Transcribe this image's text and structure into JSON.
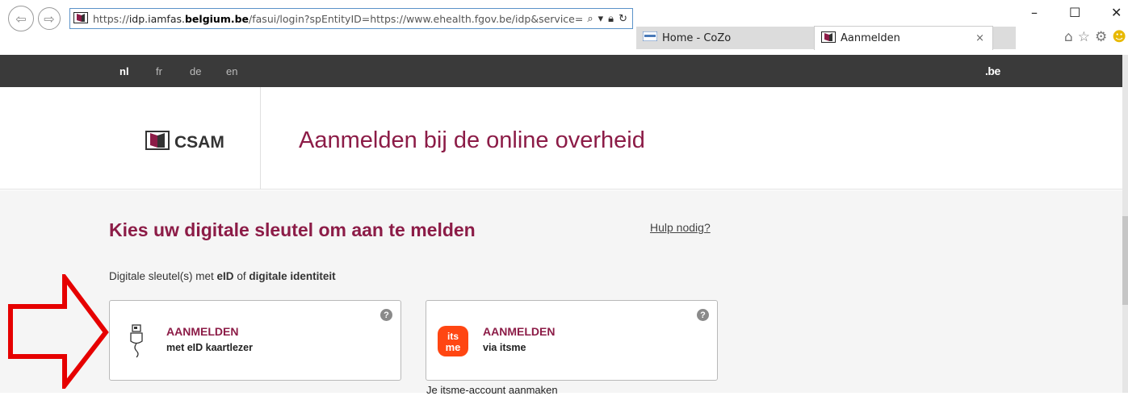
{
  "browser": {
    "url_prefix": "https://",
    "url_host_pre": "idp.iamfas.",
    "url_host_bold": "belgium.be",
    "url_path": "/fasui/login?spEntityID=https://www.ehealth.fgov.be/idp&service=Ei",
    "tabs": [
      {
        "label": "Home - CoZo"
      },
      {
        "label": "Aanmelden",
        "close": "×"
      }
    ],
    "window": {
      "minimize": "–",
      "maximize": "☐",
      "close": "✕"
    }
  },
  "site": {
    "languages": [
      {
        "code": "nl",
        "active": true
      },
      {
        "code": "fr"
      },
      {
        "code": "de"
      },
      {
        "code": "en"
      }
    ],
    "be_logo": ".be",
    "logo_text": "CSAM",
    "page_title": "Aanmelden bij de online overheid"
  },
  "main": {
    "section_title": "Kies uw digitale sleutel om aan te melden",
    "help_link": "Hulp nodig?",
    "subtitle_pre": "Digitale sleutel(s) met ",
    "subtitle_b1": "eID",
    "subtitle_mid": " of ",
    "subtitle_b2": "digitale identiteit",
    "cards": [
      {
        "title": "AANMELDEN",
        "sub": "met eID kaartlezer",
        "icon": "card-reader-icon"
      },
      {
        "title": "AANMELDEN",
        "sub": "via itsme",
        "icon": "itsme-logo"
      }
    ],
    "itsme_create": "Je itsme-account aanmaken"
  },
  "colors": {
    "brand": "#8c1c47",
    "langbar": "#3a3a3a",
    "annotation": "#e60000",
    "itsme": "#ff4612"
  }
}
